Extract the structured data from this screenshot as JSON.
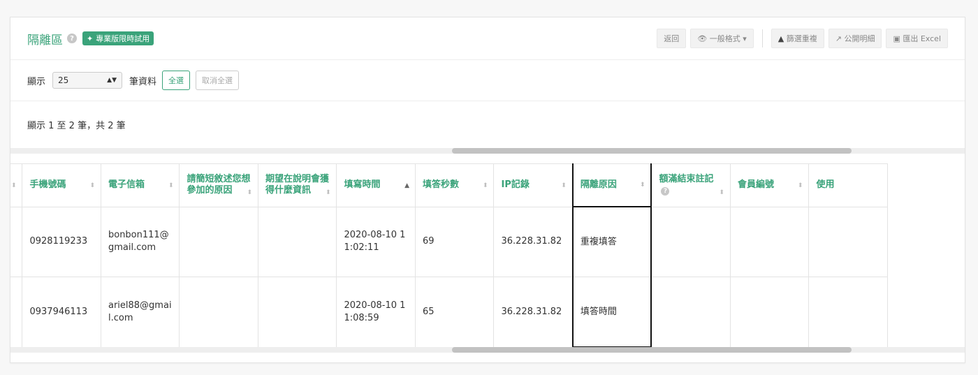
{
  "header": {
    "title": "隔離區",
    "badge": "專業版限時試用",
    "toolbar": {
      "back": "返回",
      "format": "一般格式",
      "filter_dup": "篩選重複",
      "public_detail": "公開明細",
      "export": "匯出 Excel"
    }
  },
  "controls": {
    "show_label": "顯示",
    "page_size": "25",
    "records_label": "筆資料",
    "select_all": "全選",
    "deselect_all": "取消全選"
  },
  "info": "顯示 1 至 2 筆，共 2 筆",
  "table": {
    "columns": [
      "",
      "手機號碼",
      "電子信箱",
      "請簡短敘述您想參加的原因",
      "期望在說明會獲得什麼資訊",
      "填寫時間",
      "填答秒數",
      "IP記錄",
      "隔離原因",
      "額滿結束註記",
      "會員編號",
      "使用"
    ],
    "rows": [
      [
        "",
        "0928119233",
        "bonbon111@gmail.com",
        "",
        "",
        "2020-08-10 11:02:11",
        "69",
        "36.228.31.82",
        "重複填答",
        "",
        "",
        ""
      ],
      [
        "",
        "0937946113",
        "ariel88@gmail.com",
        "",
        "",
        "2020-08-10 11:08:59",
        "65",
        "36.228.31.82",
        "填答時間",
        "",
        "",
        ""
      ]
    ]
  },
  "colors": {
    "accent": "#3aa37a"
  }
}
